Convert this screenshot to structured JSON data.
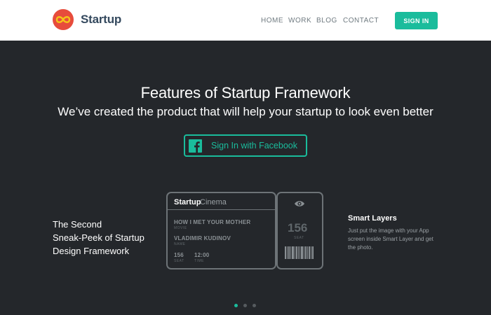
{
  "header": {
    "brand": "Startup",
    "nav": [
      "HOME",
      "WORK",
      "BLOG",
      "CONTACT"
    ],
    "signin_label": "SIGN IN"
  },
  "hero": {
    "title": "Features of Startup Framework",
    "subtitle": "We’ve created the product that will help your startup to look even better",
    "facebook_button": "Sign In with Facebook"
  },
  "sneak_peek": {
    "lines": [
      "The Second",
      "Sneak-Peek of Startup",
      "Design Framework"
    ]
  },
  "ticket": {
    "brand": "Startup",
    "brand_sub": "Cinema",
    "movie": "HOW I MET YOUR MOTHER",
    "movie_label": "MOVIE",
    "name": "VLADIMIR KUDINOV",
    "name_label": "NAME",
    "seat": "156",
    "seat_label": "SEAT",
    "time": "12:00",
    "time_label": "TIME",
    "stub_seat": "156",
    "stub_seat_label": "SEAT"
  },
  "smart_layers": {
    "title": "Smart Layers",
    "description": "Just put the image with your App screen inside Smart Layer and get the photo."
  },
  "carousel": {
    "active_index": 0,
    "count": 3
  },
  "colors": {
    "accent": "#1abc9c",
    "logo": "#e74c3c",
    "background": "#24272b"
  }
}
